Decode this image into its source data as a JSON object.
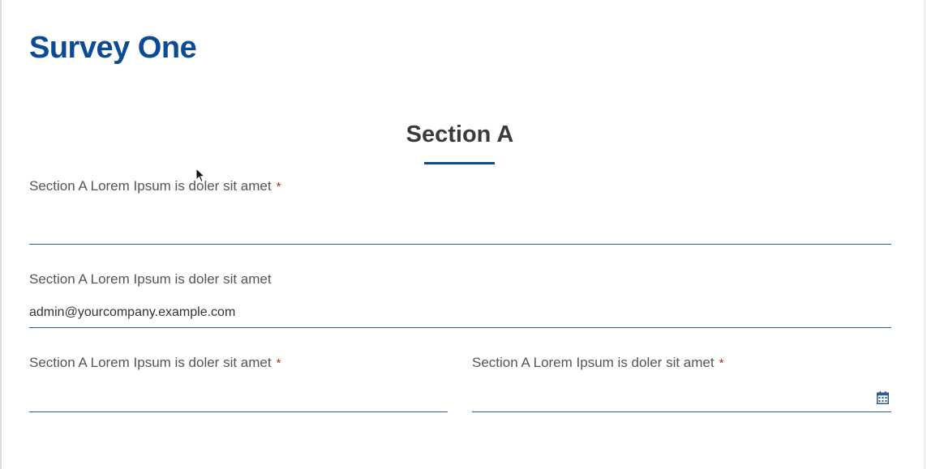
{
  "survey": {
    "title": "Survey One"
  },
  "section": {
    "heading": "Section A"
  },
  "fields": {
    "field1": {
      "label": "Section A Lorem Ipsum is doler sit amet",
      "required_mark": "*",
      "value": ""
    },
    "field2": {
      "label": "Section A Lorem Ipsum is doler sit amet",
      "value": "admin@yourcompany.example.com"
    },
    "field3": {
      "label": "Section A Lorem Ipsum is doler sit amet",
      "required_mark": "*",
      "value": ""
    },
    "field4": {
      "label": "Section A Lorem Ipsum is doler sit amet",
      "required_mark": "*",
      "value": "",
      "icon": "calendar-icon"
    }
  },
  "colors": {
    "brand": "#0b4a94",
    "heading": "#3a3a3a",
    "label": "#555555",
    "required": "#b3261e",
    "field_line": "#2b5d8f"
  }
}
